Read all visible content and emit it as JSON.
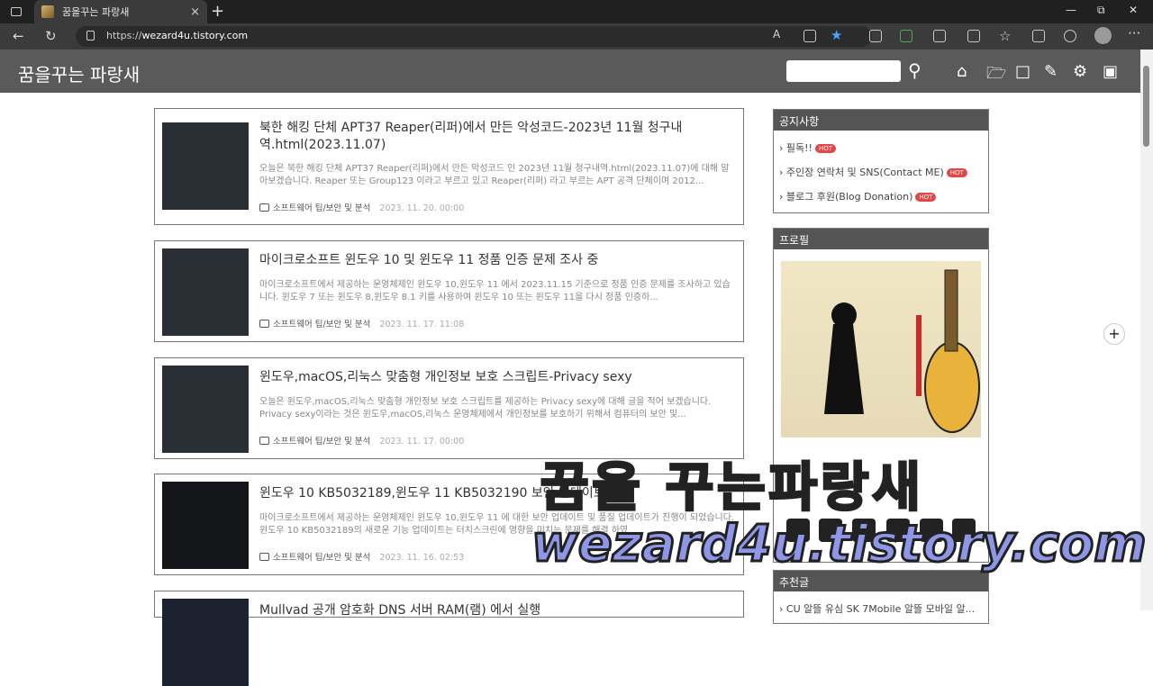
{
  "browser": {
    "tab_title": "꿈을꾸는 파랑새",
    "tab_close": "×",
    "new_tab": "+",
    "url_host": "wezard4u.tistory.com",
    "url_prefix": "https://"
  },
  "blog": {
    "title": "꿈을꾸는 파랑새",
    "search_placeholder": ""
  },
  "posts": [
    {
      "title": "북한 해킹 단체 APT37 Reaper(리퍼)에서 만든 악성코드-2023년 11월 청구내역.html(2023.11.07)",
      "desc": "오늘은 북한 해킹 단체 APT37 Reaper(리퍼)에서 만든 악성코드 인 2023년 11월 청구내역.html(2023.11.07)에 대해 알아보겠습니다. Reaper 또는 Group123 이라고 부르고 있고 Reaper(리퍼) 라고 부르는 APT 공격 단체이며 2012...",
      "category": "소프트웨어 팁/보안 및 분석",
      "date": "2023. 11. 20. 00:00"
    },
    {
      "title": "마이크로소프트 윈도우 10 및 윈도우 11 정품 인증 문제 조사 중",
      "desc": "마이크로소프트에서 제공하는 운영체제인 윈도우 10,윈도우 11 에서 2023.11.15 기준으로 정품 인증 문제를 조사하고 있습니다. 윈도우 7 또는 윈도우 8,윈도우 8.1 키를 사용하여 윈도우 10 또는 윈도우 11을 다시 정품 인증하...",
      "category": "소프트웨어 팁/보안 및 분석",
      "date": "2023. 11. 17. 11:08"
    },
    {
      "title": "윈도우,macOS,리눅스 맞춤형 개인정보 보호 스크립트-Privacy sexy",
      "desc": "오늘은 윈도우,macOS,리눅스 맞춤형 개인정보 보호 스크립트를 제공하는 Privacy sexy에 대해 글을 적어 보겠습니다. Privacy sexy이라는 것은 윈도우,macOS,리눅스 운영체제에서 개인정보를 보호하기 위해서 컴퓨터의 보안 및...",
      "category": "소프트웨어 팁/보안 및 분석",
      "date": "2023. 11. 17. 00:00"
    },
    {
      "title": "윈도우 10 KB5032189,윈도우 11 KB5032190 보안 업데이트",
      "desc": "마이크로소프트에서 제공하는 운영체제인 윈도우 10,윈도우 11 에 대한 보안 업데이트 및 품질 업데이트가 진행이 되었습니다. 윈도우 10 KB5032189의 새로운 기능 업데이트는 터치스크린에 영향을 미치는 문제를 해결 하였...",
      "category": "소프트웨어 팁/보안 및 분석",
      "date": "2023. 11. 16. 02:53"
    },
    {
      "title": "Mullvad 공개 암호화 DNS 서버 RAM(램) 에서 실행",
      "desc": "",
      "category": "",
      "date": ""
    }
  ],
  "sidebar": {
    "notice_title": "공지사항",
    "notices": [
      {
        "label": "필독!!",
        "badge": "HOT"
      },
      {
        "label": "주인장 연락처 및 SNS(Contact ME)",
        "badge": "HOT"
      },
      {
        "label": "블로그 후원(Blog Donation)",
        "badge": "HOT"
      }
    ],
    "profile_title": "프로필",
    "recommend_title": "추천글",
    "recommend_first": "CU 알뜰 유심 SK 7Mobile 알뜰 모바일 알..."
  },
  "watermark": {
    "line1": "꿈을 꾸는파랑새",
    "line2": "wezard4u.tistory.com"
  },
  "colors": {
    "header_bg": "#5a5a5a",
    "sidebar_head_bg": "#555555",
    "hot_badge": "#e64545",
    "watermark": "#8d96e7"
  }
}
